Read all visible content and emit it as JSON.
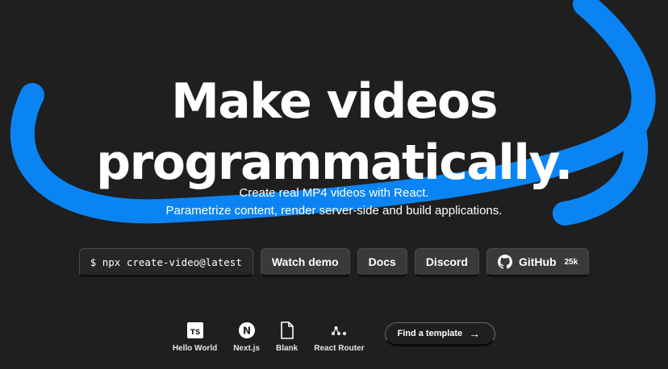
{
  "theme": {
    "background": "#1f1f1f",
    "accent": "#0b84f3",
    "button_bg": "#3a3a3a",
    "command_bg": "#262626"
  },
  "hero": {
    "title_line1": "Make videos",
    "title_line2": "programmatically.",
    "subtitle_line1": "Create real MP4 videos with React.",
    "subtitle_line2": "Parametrize content, render server-side and build applications."
  },
  "actions": {
    "command": "$ npx create-video@latest",
    "watch_demo": "Watch demo",
    "docs": "Docs",
    "discord": "Discord",
    "github": "GitHub",
    "github_stars": "25k",
    "github_icon": "github-icon"
  },
  "templates": {
    "items": [
      {
        "label": "Hello World",
        "icon": "typescript-icon",
        "icon_text": "TS"
      },
      {
        "label": "Next.js",
        "icon": "nextjs-icon",
        "icon_text": "N"
      },
      {
        "label": "Blank",
        "icon": "file-icon"
      },
      {
        "label": "React Router",
        "icon": "react-router-icon"
      }
    ],
    "find_label": "Find a template",
    "find_arrow": "→"
  }
}
